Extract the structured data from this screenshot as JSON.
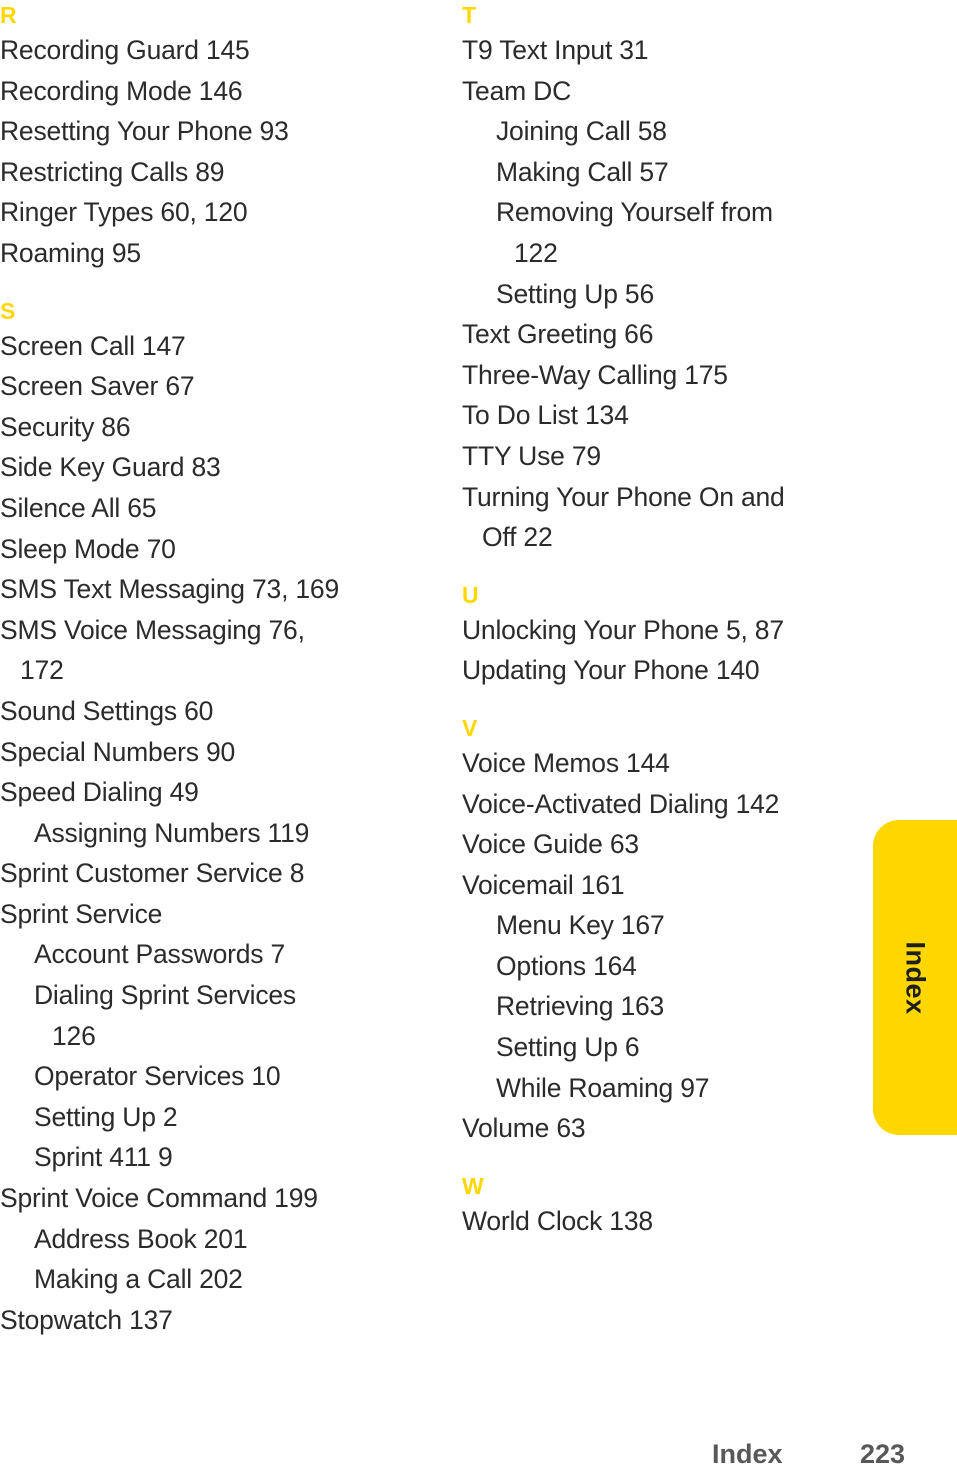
{
  "page": {
    "type": "index",
    "background_color": "#FFFFFF",
    "text_color": "#2B2B2B"
  },
  "theme": {
    "accent_yellow": "#FFD700",
    "footer_gray": "#58585A"
  },
  "side_tab": {
    "label": "Index",
    "color": "#FFD700"
  },
  "footer": {
    "label": "Index",
    "page_number": "223"
  },
  "columns": [
    {
      "id": "left",
      "sections": [
        {
          "letter": "R",
          "entries": [
            {
              "text": "Recording Guard 145",
              "level": 0,
              "continuation": false
            },
            {
              "text": "Recording Mode 146",
              "level": 0,
              "continuation": false
            },
            {
              "text": "Resetting Your Phone 93",
              "level": 0,
              "continuation": false
            },
            {
              "text": "Restricting Calls 89",
              "level": 0,
              "continuation": false
            },
            {
              "text": "Ringer Types 60, 120",
              "level": 0,
              "continuation": false
            },
            {
              "text": "Roaming 95",
              "level": 0,
              "continuation": false
            }
          ]
        },
        {
          "letter": "S",
          "entries": [
            {
              "text": "Screen Call 147",
              "level": 0,
              "continuation": false
            },
            {
              "text": "Screen Saver 67",
              "level": 0,
              "continuation": false
            },
            {
              "text": "Security 86",
              "level": 0,
              "continuation": false
            },
            {
              "text": "Side Key Guard 83",
              "level": 0,
              "continuation": false
            },
            {
              "text": "Silence All 65",
              "level": 0,
              "continuation": false
            },
            {
              "text": "Sleep Mode 70",
              "level": 0,
              "continuation": false
            },
            {
              "text": "SMS Text Messaging 73, 169",
              "level": 0,
              "continuation": false
            },
            {
              "text": "SMS Voice Messaging 76,",
              "level": 0,
              "continuation": false
            },
            {
              "text": "172",
              "level": 0,
              "continuation": true
            },
            {
              "text": "Sound Settings 60",
              "level": 0,
              "continuation": false
            },
            {
              "text": "Special Numbers 90",
              "level": 0,
              "continuation": false
            },
            {
              "text": "Speed Dialing 49",
              "level": 0,
              "continuation": false
            },
            {
              "text": "Assigning Numbers 119",
              "level": 1,
              "continuation": false
            },
            {
              "text": "Sprint Customer Service 8",
              "level": 0,
              "continuation": false
            },
            {
              "text": "Sprint Service",
              "level": 0,
              "continuation": false
            },
            {
              "text": "Account Passwords 7",
              "level": 1,
              "continuation": false
            },
            {
              "text": "Dialing Sprint Services",
              "level": 1,
              "continuation": false
            },
            {
              "text": "126",
              "level": 1,
              "continuation": true
            },
            {
              "text": "Operator Services 10",
              "level": 1,
              "continuation": false
            },
            {
              "text": "Setting Up 2",
              "level": 1,
              "continuation": false
            },
            {
              "text": "Sprint 411 9",
              "level": 1,
              "continuation": false
            },
            {
              "text": "Sprint Voice Command 199",
              "level": 0,
              "continuation": false
            },
            {
              "text": "Address Book 201",
              "level": 1,
              "continuation": false
            },
            {
              "text": "Making a Call 202",
              "level": 1,
              "continuation": false
            },
            {
              "text": "Stopwatch 137",
              "level": 0,
              "continuation": false
            }
          ]
        }
      ]
    },
    {
      "id": "right",
      "sections": [
        {
          "letter": "T",
          "entries": [
            {
              "text": "T9 Text Input 31",
              "level": 0,
              "continuation": false
            },
            {
              "text": "Team DC",
              "level": 0,
              "continuation": false
            },
            {
              "text": "Joining Call 58",
              "level": 1,
              "continuation": false
            },
            {
              "text": "Making Call 57",
              "level": 1,
              "continuation": false
            },
            {
              "text": "Removing Yourself from",
              "level": 1,
              "continuation": false
            },
            {
              "text": "122",
              "level": 1,
              "continuation": true
            },
            {
              "text": "Setting Up 56",
              "level": 1,
              "continuation": false
            },
            {
              "text": "Text Greeting 66",
              "level": 0,
              "continuation": false
            },
            {
              "text": "Three-Way Calling 175",
              "level": 0,
              "continuation": false
            },
            {
              "text": "To Do List 134",
              "level": 0,
              "continuation": false
            },
            {
              "text": "TTY Use 79",
              "level": 0,
              "continuation": false
            },
            {
              "text": "Turning Your Phone On and",
              "level": 0,
              "continuation": false
            },
            {
              "text": "Off 22",
              "level": 0,
              "continuation": true
            }
          ]
        },
        {
          "letter": "U",
          "entries": [
            {
              "text": "Unlocking Your Phone 5, 87",
              "level": 0,
              "continuation": false
            },
            {
              "text": "Updating Your Phone 140",
              "level": 0,
              "continuation": false
            }
          ]
        },
        {
          "letter": "V",
          "entries": [
            {
              "text": "Voice Memos 144",
              "level": 0,
              "continuation": false
            },
            {
              "text": "Voice-Activated Dialing 142",
              "level": 0,
              "continuation": false
            },
            {
              "text": "Voice Guide 63",
              "level": 0,
              "continuation": false
            },
            {
              "text": "Voicemail 161",
              "level": 0,
              "continuation": false
            },
            {
              "text": "Menu Key 167",
              "level": 1,
              "continuation": false
            },
            {
              "text": "Options 164",
              "level": 1,
              "continuation": false
            },
            {
              "text": "Retrieving 163",
              "level": 1,
              "continuation": false
            },
            {
              "text": "Setting Up 6",
              "level": 1,
              "continuation": false
            },
            {
              "text": "While Roaming 97",
              "level": 1,
              "continuation": false
            },
            {
              "text": "Volume 63",
              "level": 0,
              "continuation": false
            }
          ]
        },
        {
          "letter": "W",
          "entries": [
            {
              "text": "World Clock 138",
              "level": 0,
              "continuation": false
            }
          ]
        }
      ]
    }
  ]
}
